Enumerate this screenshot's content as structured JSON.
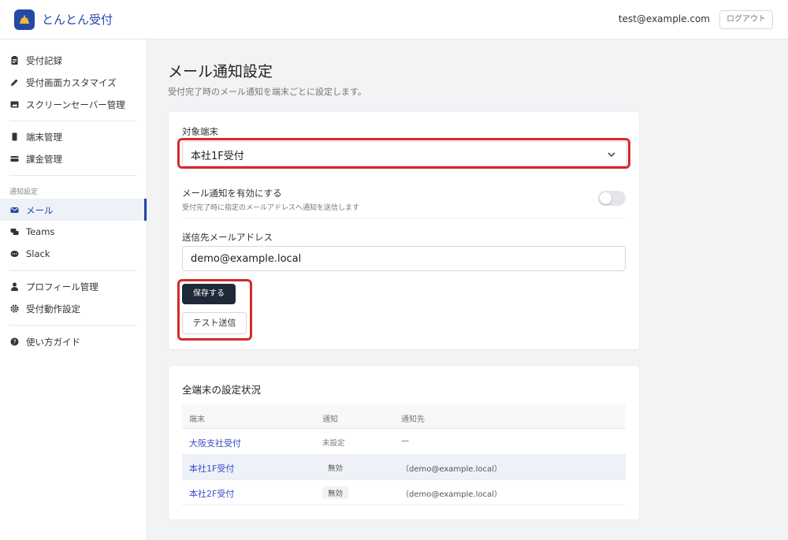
{
  "header": {
    "app_title": "とんとん受付",
    "user_email": "test@example.com",
    "logout_label": "ログアウト",
    "logo_icon": "bell-icon",
    "accent": "#2448a8"
  },
  "sidebar": {
    "items": [
      {
        "label": "受付記録",
        "icon": "clipboard-icon"
      },
      {
        "label": "受付画面カスタマイズ",
        "icon": "pencil-icon"
      },
      {
        "label": "スクリーンセーバー管理",
        "icon": "image-icon"
      },
      {
        "label": "端末管理",
        "icon": "device-icon"
      },
      {
        "label": "課金管理",
        "icon": "credit-card-icon"
      }
    ],
    "section_label": "通知設定",
    "notify_items": [
      {
        "label": "メール",
        "icon": "mail-icon",
        "active": true
      },
      {
        "label": "Teams",
        "icon": "chat-icon"
      },
      {
        "label": "Slack",
        "icon": "speech-bubble-icon"
      }
    ],
    "bottom_items": [
      {
        "label": "プロフィール管理",
        "icon": "user-icon"
      },
      {
        "label": "受付動作設定",
        "icon": "gear-icon"
      }
    ],
    "help_item": {
      "label": "使い方ガイド",
      "icon": "question-icon"
    }
  },
  "main": {
    "title": "メール通知設定",
    "subtitle": "受付完了時のメール通知を端末ごとに設定します。",
    "target_label": "対象端末",
    "target_value": "本社1F受付",
    "enable_title": "メール通知を有効にする",
    "enable_desc": "受付完了時に指定のメールアドレスへ通知を送信します",
    "enable_state": false,
    "email_label": "送信先メールアドレス",
    "email_value": "demo@example.local",
    "save_label": "保存する",
    "test_label": "テスト送信"
  },
  "status_table": {
    "title": "全端末の設定状況",
    "headers": [
      "端末",
      "通知",
      "通知先"
    ],
    "rows": [
      {
        "terminal": "大阪支社受付",
        "status": "未設定",
        "dest": "—"
      },
      {
        "terminal": "本社1F受付",
        "status": "無効",
        "dest": "（demo@example.local）"
      },
      {
        "terminal": "本社2F受付",
        "status": "無効",
        "dest": "（demo@example.local）"
      }
    ]
  },
  "colors": {
    "highlight": "#d42a2a",
    "primary_button": "#1f2937",
    "link": "#3a4fc4"
  }
}
